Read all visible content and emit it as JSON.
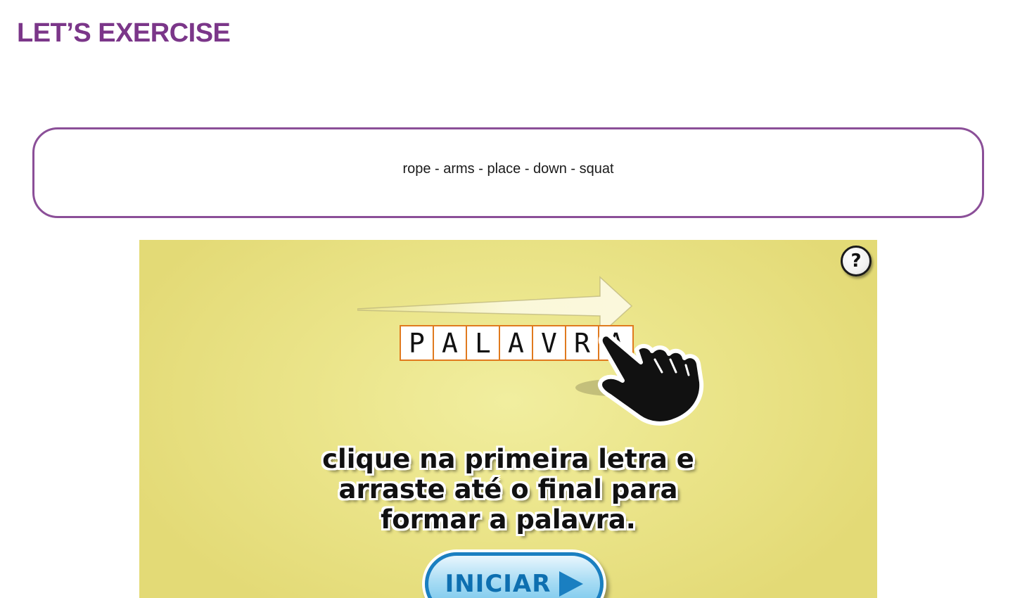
{
  "header": {
    "title": "LET’S EXERCISE"
  },
  "word_bank": {
    "text": "rope - arms - place - down - squat"
  },
  "game": {
    "help_label": "?",
    "demo_letters": [
      "P",
      "A",
      "L",
      "A",
      "V",
      "R",
      "A"
    ],
    "instruction_lines": [
      "clique na primeira letra e",
      "arraste até o final para",
      "formar a palavra."
    ],
    "start_label": "INICIAR"
  },
  "colors": {
    "accent": "#7b3689",
    "box_border": "#8b4f98",
    "game_background": "#ebe58b",
    "letter_border": "#e07a1e",
    "button_blue": "#1a7fc1"
  },
  "icons": [
    "question-icon",
    "arrow-right-icon",
    "hand-pointer-icon",
    "play-icon"
  ]
}
